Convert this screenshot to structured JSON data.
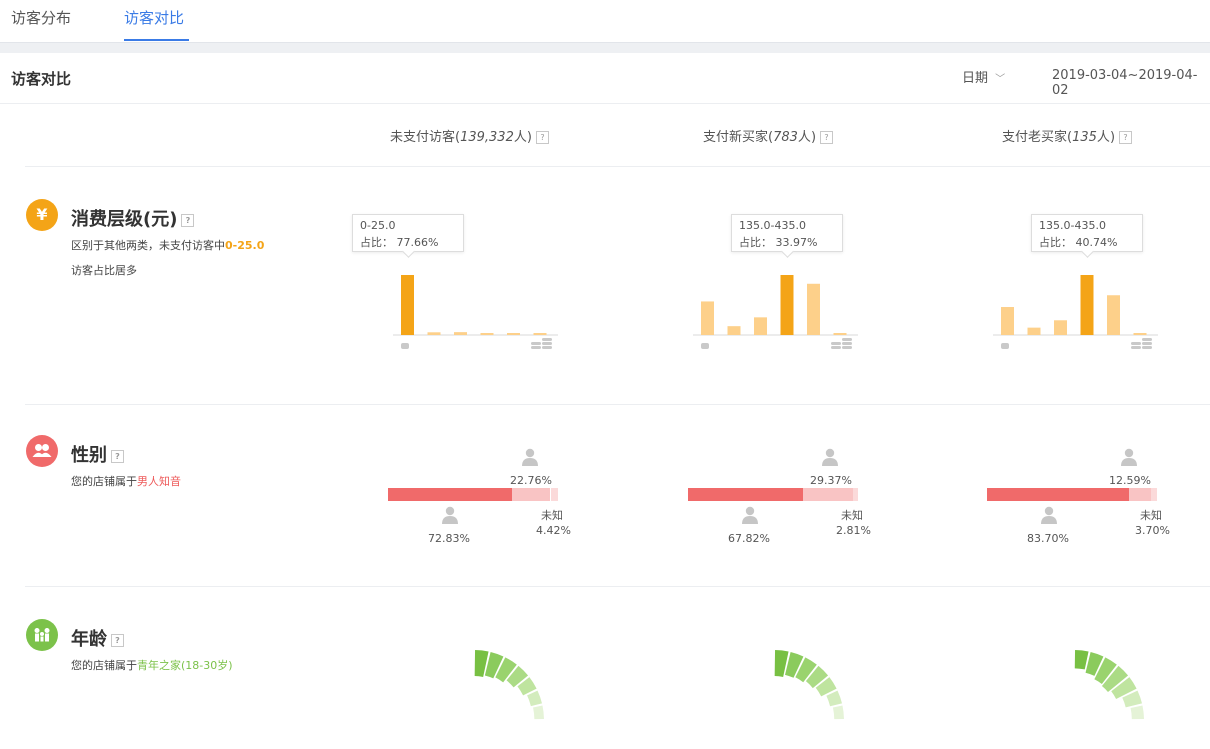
{
  "tabs": [
    {
      "label": "访客分布",
      "active": false
    },
    {
      "label": "访客对比",
      "active": true
    }
  ],
  "header": {
    "title": "访客对比",
    "date_label": "日期",
    "date_range": "2019-03-04~2019-04-02"
  },
  "columns": [
    {
      "name": "未支付访客",
      "count": "139,332",
      "unit": "人"
    },
    {
      "name": "支付新买家",
      "count": "783",
      "unit": "人"
    },
    {
      "name": "支付老买家",
      "count": "135",
      "unit": "人"
    }
  ],
  "spending": {
    "title": "消费层级(元)",
    "icon": "yen-icon",
    "icon_symbol": "¥",
    "desc_pre": "区别于其他两类，未支付访客中",
    "desc_hl": "0-25.0",
    "desc_post": "访客占比居多",
    "accent": "#f4a417",
    "light": "#fdd08a",
    "tooltip_pct_label": "占比："
  },
  "gender": {
    "title": "性别",
    "icon": "people-icon",
    "desc_pre": "您的店铺属于",
    "desc_hl": "男人知音",
    "unknown_label": "未知",
    "accent": "#f06a6a",
    "light": "#f9c4c4"
  },
  "age": {
    "title": "年龄",
    "icon": "family-icon",
    "desc_pre": "您的店铺属于",
    "desc_hl": "青年之家(18-30岁)",
    "accent": "#7cc24a"
  },
  "chart_data": [
    {
      "type": "bar",
      "title": "未支付访客 消费层级",
      "values": [
        77.66,
        3.5,
        3.7,
        2.5,
        1.5,
        1.0
      ],
      "highlight_index": 0,
      "tooltip": {
        "range": "0-25.0",
        "percent": "77.66%"
      }
    },
    {
      "type": "bar",
      "title": "支付新买家 消费层级",
      "values": [
        19,
        5,
        10,
        33.97,
        29,
        1
      ],
      "highlight_index": 3,
      "tooltip": {
        "range": "135.0-435.0",
        "percent": "33.97%"
      }
    },
    {
      "type": "bar",
      "title": "支付老买家 消费层级",
      "values": [
        19,
        5,
        10,
        40.74,
        27,
        1
      ],
      "highlight_index": 3,
      "tooltip": {
        "range": "135.0-435.0",
        "percent": "40.74%"
      }
    }
  ],
  "gender_data": [
    {
      "male": "72.83%",
      "female": "22.76%",
      "unknown": "4.42%",
      "male_v": 72.83,
      "female_v": 22.76,
      "unknown_v": 4.42
    },
    {
      "male": "67.82%",
      "female": "29.37%",
      "unknown": "2.81%",
      "male_v": 67.82,
      "female_v": 29.37,
      "unknown_v": 2.81
    },
    {
      "male": "83.70%",
      "female": "12.59%",
      "unknown": "3.70%",
      "male_v": 83.7,
      "female_v": 12.59,
      "unknown_v": 3.7
    }
  ],
  "age_data": [
    {
      "segments": [
        22,
        20,
        18,
        14,
        10,
        6,
        4
      ]
    },
    {
      "segments": [
        16,
        14,
        13,
        11,
        9,
        5,
        3
      ]
    },
    {
      "segments": [
        8,
        10,
        12,
        13,
        11,
        7,
        4
      ]
    }
  ]
}
